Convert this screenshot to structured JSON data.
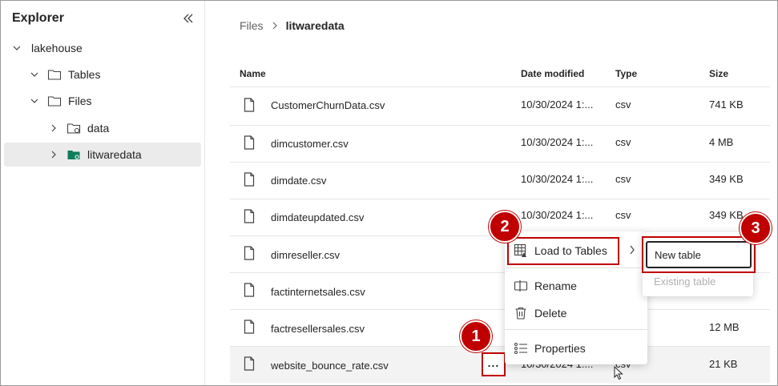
{
  "sidebar": {
    "title": "Explorer",
    "tree": [
      {
        "label": "lakehouse",
        "expanded": true
      },
      {
        "label": "Tables",
        "expanded": true
      },
      {
        "label": "Files",
        "expanded": true
      },
      {
        "label": "data",
        "expanded": false
      },
      {
        "label": "litwaredata",
        "expanded": false,
        "selected": true
      }
    ]
  },
  "breadcrumb": {
    "root": "Files",
    "current": "litwaredata"
  },
  "table": {
    "headers": {
      "name": "Name",
      "date": "Date modified",
      "type": "Type",
      "size": "Size"
    },
    "rows": [
      {
        "name": "CustomerChurnData.csv",
        "date": "10/30/2024 1:...",
        "type": "csv",
        "size": "741 KB"
      },
      {
        "name": "dimcustomer.csv",
        "date": "10/30/2024 1:...",
        "type": "csv",
        "size": "4 MB"
      },
      {
        "name": "dimdate.csv",
        "date": "10/30/2024 1:...",
        "type": "csv",
        "size": "349 KB"
      },
      {
        "name": "dimdateupdated.csv",
        "date": "10/30/2024 1:...",
        "type": "csv",
        "size": "349 KB"
      },
      {
        "name": "dimreseller.csv",
        "date": "",
        "type": "",
        "size": ""
      },
      {
        "name": "factinternetsales.csv",
        "date": "",
        "type": "",
        "size": ""
      },
      {
        "name": "factresellersales.csv",
        "date": "",
        "type": "",
        "size": "12 MB"
      },
      {
        "name": "website_bounce_rate.csv",
        "date": "10/30/2024 1:...",
        "type": "csv",
        "size": "21 KB"
      }
    ]
  },
  "more_button": {
    "label": "..."
  },
  "context_menu": {
    "items": [
      "Load to Tables",
      "Rename",
      "Delete",
      "Properties"
    ]
  },
  "submenu": {
    "items": [
      "New table",
      "Existing table"
    ]
  },
  "badges": [
    "1",
    "2",
    "3"
  ],
  "colors": {
    "annotation": "#c00000",
    "folder_selected": "#107c5a"
  }
}
